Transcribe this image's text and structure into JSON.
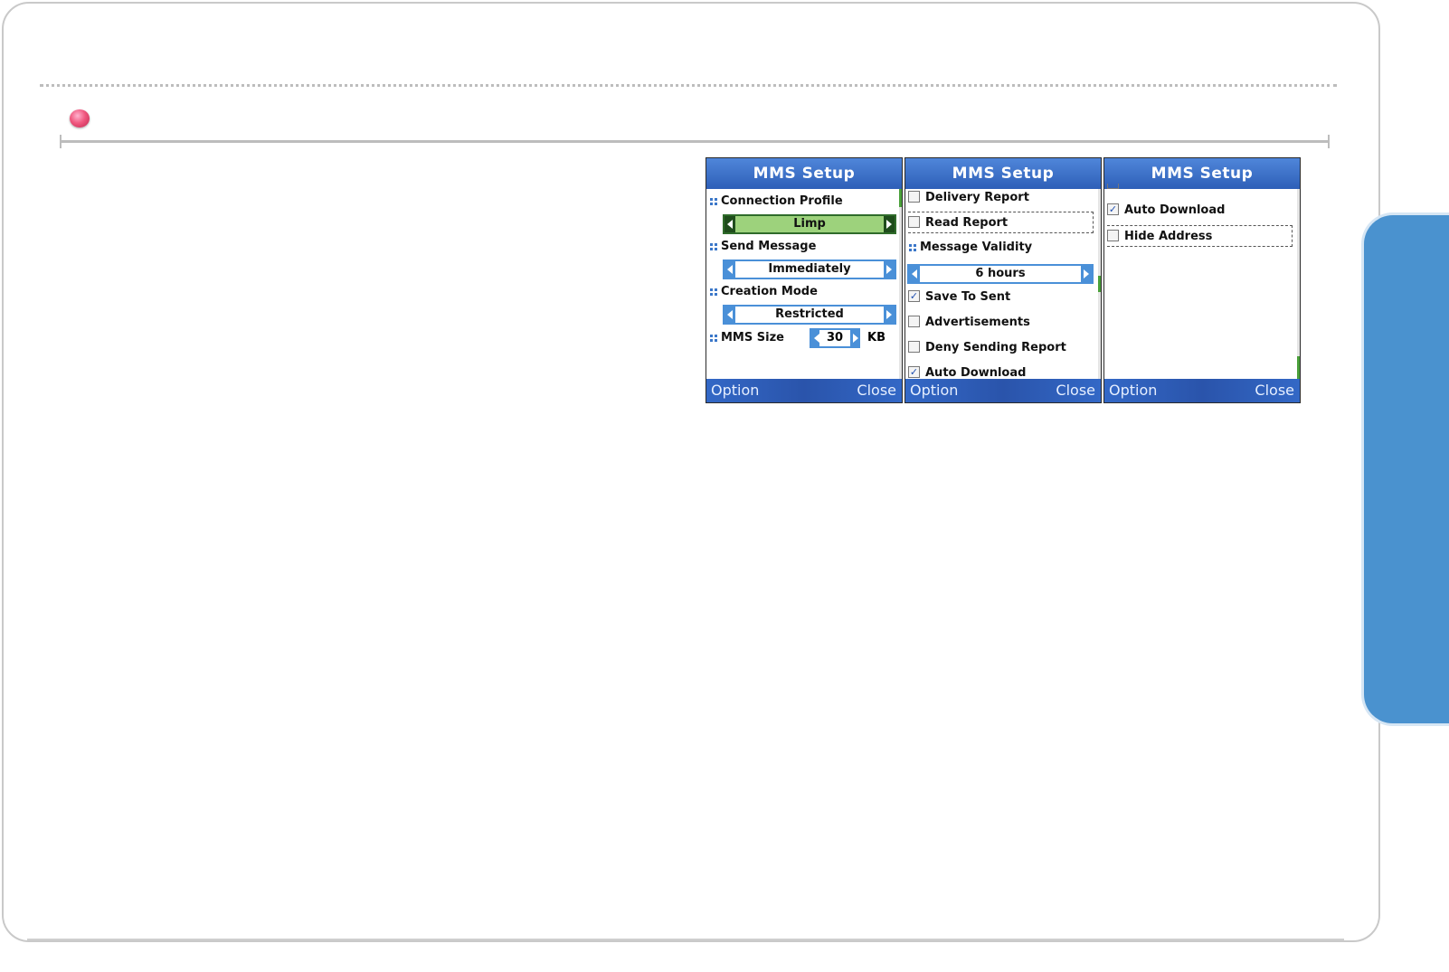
{
  "colors": {
    "side_tab": "#4a92cf",
    "bullet": "#e85a80",
    "title_bar": "#2e5fb8",
    "highlight": "#9dd27c"
  },
  "screens": [
    {
      "title": "MMS Setup",
      "soft_left": "Option",
      "soft_right": "Close",
      "connection_profile_label": "Connection Profile",
      "connection_profile_value": "Limp",
      "send_message_label": "Send Message",
      "send_message_value": "Immediately",
      "creation_mode_label": "Creation Mode",
      "creation_mode_value": "Restricted",
      "mms_size_label": "MMS Size",
      "mms_size_value": "30",
      "mms_size_unit": "KB"
    },
    {
      "title": "MMS Setup",
      "soft_left": "Option",
      "soft_right": "Close",
      "delivery_report": "Delivery Report",
      "read_report": "Read Report",
      "message_validity_label": "Message Validity",
      "message_validity_value": "6 hours",
      "save_to_sent": "Save To Sent",
      "advertisements": "Advertisements",
      "deny_sending_report": "Deny Sending Report",
      "auto_download_partial": "Auto Download"
    },
    {
      "title": "MMS Setup",
      "soft_left": "Option",
      "soft_right": "Close",
      "auto_download": "Auto Download",
      "hide_address": "Hide Address"
    }
  ]
}
